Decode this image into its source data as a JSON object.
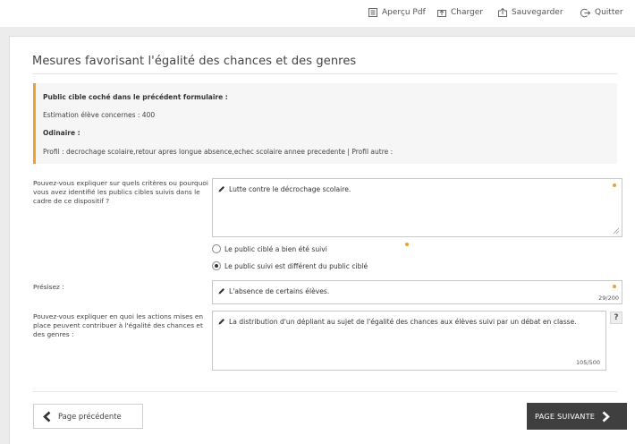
{
  "toolbar": {
    "pdf_label": "Aperçu Pdf",
    "load_label": "Charger",
    "save_label": "Sauvegarder",
    "quit_label": "Quitter"
  },
  "section": {
    "title": "Mesures favorisant l'égalité des chances et des genres"
  },
  "info": {
    "heading": "Public cible coché dans le précédent formulaire :",
    "estimate": "Estimation élève concernes : 400",
    "category": "Odinaire :",
    "profile": "Profil : decrochage scolaire,retour apres longue absence,echec scolaire annee precedente | Profil autre :"
  },
  "question1": {
    "label": "Pouvez-vous expliquer sur quels critères ou pourquoi vous avez identifié les publics cibles suivis dans le cadre de ce dispositif ?",
    "value": "Lutte contre le décrochage scolaire."
  },
  "radios": {
    "option1": "Le public ciblé a bien été suivi",
    "option2": "Le public suivi est différent du public ciblé",
    "selected": "option2"
  },
  "question2": {
    "label": "Présisez :",
    "value": "L'absence de certains élèves.",
    "counter": "29/200"
  },
  "question3": {
    "label": "Pouvez-vous expliquer en quoi les actions mises en place peuvent contribuer à l'égalité des chances et des genres :",
    "value": "La distribution d'un dépliant au sujet de l'égalité des chances aux élèves suivi par un débat en classe.",
    "counter": "105/500",
    "help": "?"
  },
  "nav": {
    "prev_label": "Page précédente",
    "next_label": "PAGE SUIVANTE"
  },
  "colors": {
    "accent": "#f0a030",
    "next_button": "#3f3f3f",
    "page_background": "#ececec"
  },
  "icons": {
    "pdf": "pdf-preview-icon",
    "load": "upload-icon",
    "save": "save-icon",
    "quit": "logout-icon",
    "edit": "pencil-icon",
    "prev": "chevron-left-icon",
    "next": "chevron-right-icon"
  }
}
